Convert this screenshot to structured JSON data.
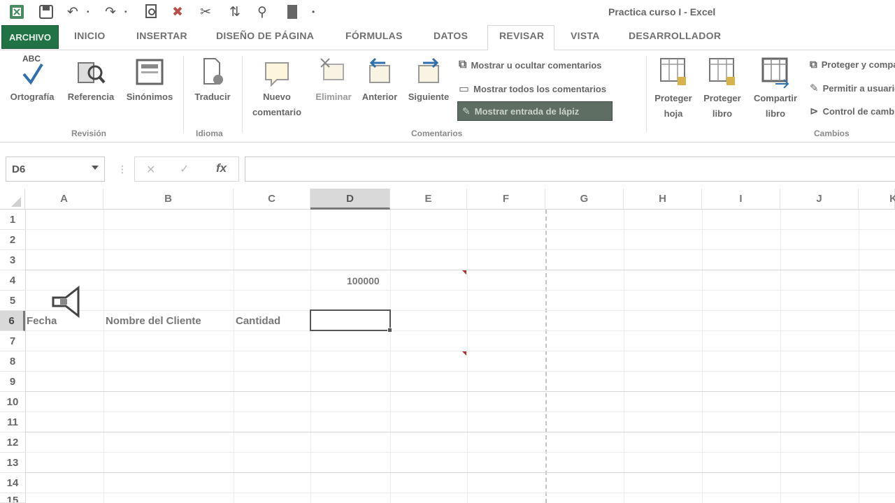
{
  "window": {
    "title": "Practica curso I - Excel"
  },
  "qat": {
    "icons": [
      "excel-logo",
      "save",
      "undo",
      "redo",
      "print-preview",
      "clear",
      "clear-formats",
      "sort",
      "filter",
      "form"
    ]
  },
  "tabs": {
    "file": "ARCHIVO",
    "items": [
      "INICIO",
      "INSERTAR",
      "DISEÑO DE PÁGINA",
      "FÓRMULAS",
      "DATOS",
      "REVISAR",
      "VISTA",
      "DESARROLLADOR"
    ],
    "active": "REVISAR"
  },
  "ribbon": {
    "revision": {
      "label": "Revisión",
      "abc": "ABC",
      "spelling": "Ortografía",
      "research": "Referencia",
      "thesaurus": "Sinónimos"
    },
    "language": {
      "label": "Idioma",
      "translate": "Traducir"
    },
    "comments": {
      "label": "Comentarios",
      "new_line1": "Nuevo",
      "new_line2": "comentario",
      "delete": "Eliminar",
      "previous": "Anterior",
      "next": "Siguiente",
      "show_hide": "Mostrar u ocultar comentarios",
      "show_all": "Mostrar todos los comentarios",
      "show_ink": "Mostrar entrada de lápiz"
    },
    "changes": {
      "label": "Cambios",
      "protect_sheet_1": "Proteger",
      "protect_sheet_2": "hoja",
      "protect_book_1": "Proteger",
      "protect_book_2": "libro",
      "share_book_1": "Compartir",
      "share_book_2": "libro",
      "protect_share": "Proteger y compartir libro",
      "allow_edit": "Permitir a usuarios modificar rangos",
      "track_changes": "Control de cambios"
    }
  },
  "formula_bar": {
    "name_box": "D6",
    "value": ""
  },
  "grid": {
    "columns": [
      "A",
      "B",
      "C",
      "D",
      "E",
      "F",
      "G",
      "H",
      "I",
      "J",
      "K"
    ],
    "selected_column": "D",
    "rows": [
      "1",
      "2",
      "3",
      "4",
      "5",
      "6",
      "7",
      "8",
      "9",
      "10",
      "11",
      "12",
      "13",
      "14",
      "15"
    ],
    "cells": {
      "D4": "100000",
      "A6": "Fecha",
      "B6": "Nombre del Cliente",
      "C6": "Cantidad"
    }
  },
  "colors": {
    "accent": "#217346",
    "comment_marker": "#b03030"
  }
}
